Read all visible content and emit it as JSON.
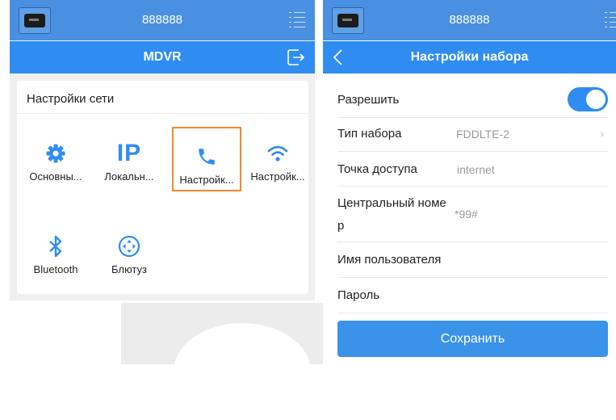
{
  "left_screen": {
    "status_title": "888888",
    "nav_title": "MDVR",
    "section_title": "Настройки сети",
    "tiles": [
      {
        "label": "Основны...",
        "icon": "gear-icon"
      },
      {
        "label": "Локальн...",
        "icon": "ip-icon"
      },
      {
        "label": "Настройк...",
        "icon": "phone-icon",
        "selected": true
      },
      {
        "label": "Настройк...",
        "icon": "wifi-icon"
      },
      {
        "label": "Bluetooth",
        "icon": "bluetooth-icon"
      },
      {
        "label": "Блютуз",
        "icon": "dpad-icon"
      }
    ],
    "ip_glyph": "IP"
  },
  "right_screen": {
    "status_title": "888888",
    "nav_title": "Настройки набора",
    "rows": {
      "enable": {
        "label": "Разрешить",
        "value": true
      },
      "dial_type": {
        "label": "Тип набора",
        "value": "FDDLTE-2"
      },
      "apn": {
        "label": "Точка доступа",
        "value": "internet"
      },
      "center_number": {
        "label_line1": "Центральный номе",
        "label_line2": "р",
        "value": "*99#"
      },
      "username": {
        "label": "Имя пользователя",
        "value": ""
      },
      "password": {
        "label": "Пароль",
        "value": ""
      }
    },
    "save_label": "Сохранить",
    "chevron": "›"
  },
  "colors": {
    "status_bar": "#4a90e2",
    "nav_bar": "#2f8df2",
    "accent": "#2f8df2",
    "selected_border": "#f08a2c",
    "save_button": "#3a93e8"
  }
}
